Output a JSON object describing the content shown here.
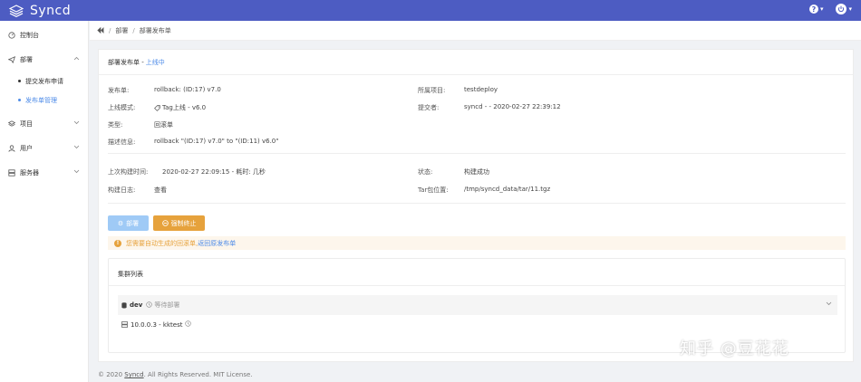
{
  "app": {
    "name": "Syncd"
  },
  "header": {
    "help_chevron": "▾",
    "user_chevron": "▾"
  },
  "sidebar": {
    "items": [
      {
        "label": "控制台",
        "icon": "gauge-icon"
      },
      {
        "label": "部署",
        "icon": "send-icon",
        "expanded": true,
        "children": [
          {
            "label": "提交发布申请"
          },
          {
            "label": "发布单管理",
            "active": true
          }
        ]
      },
      {
        "label": "项目",
        "icon": "layers-icon"
      },
      {
        "label": "用户",
        "icon": "user-icon"
      },
      {
        "label": "服务器",
        "icon": "server-icon"
      }
    ]
  },
  "breadcrumb": {
    "items": [
      "部署",
      "部署发布单"
    ]
  },
  "card": {
    "title": "部署发布单 -",
    "status": "上线中",
    "fields": {
      "release_label": "发布单:",
      "release_value": "rollback: (ID:17) v7.0",
      "project_label": "所属项目:",
      "project_value": "testdeploy",
      "mode_label": "上线模式:",
      "mode_value": "Tag上线 - v6.0",
      "submitter_label": "提交者:",
      "submitter_value": "syncd - - 2020-02-27 22:39:12",
      "type_label": "类型:",
      "type_value": "回滚单",
      "desc_label": "描述信息:",
      "desc_value": "rollback \"(ID:17) v7.0\" to \"(ID:11) v6.0\"",
      "build_time_label": "上次构建时间:",
      "build_time_value": "2020-02-27 22:09:15 - 耗时: 几秒",
      "state_label": "状态:",
      "state_value": "构建成功",
      "log_label": "构建日志:",
      "log_value": "查看",
      "tar_label": "Tar包位置:",
      "tar_value": "/tmp/syncd_data/tar/11.tgz"
    },
    "buttons": {
      "deploy": "部署",
      "stop": "强制终止"
    },
    "warning": {
      "text": "您需要自动生成的回滚单,",
      "link": "返回原发布单"
    },
    "cluster": {
      "title": "集群列表",
      "env": "dev",
      "env_status": "等待部署",
      "host": "10.0.0.3 - kktest"
    }
  },
  "footer": {
    "prefix": "© 2020",
    "link": "Syncd",
    "suffix": ". All Rights Reserved. MIT License."
  },
  "watermark": {
    "text": "知乎 @豆花花"
  },
  "colors": {
    "topbar": "#4d5cc2",
    "accent": "#4d8be8",
    "warning": "#e6a23c",
    "success": "#67c23a"
  }
}
